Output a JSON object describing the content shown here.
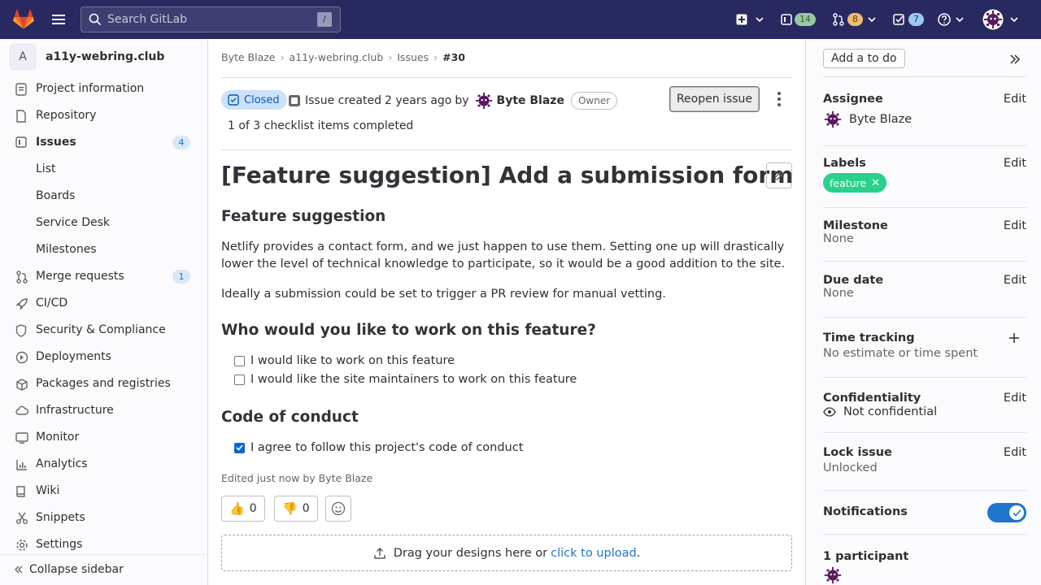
{
  "topbar": {
    "search_placeholder": "Search GitLab",
    "search_shortcut": "/",
    "issues_count": "14",
    "mr_count": "8",
    "todo_count": "7"
  },
  "sidebar": {
    "project_avatar": "A",
    "project_name": "a11y-webring.club",
    "items": [
      {
        "label": "Project information",
        "icon": "info-icon"
      },
      {
        "label": "Repository",
        "icon": "doc-icon"
      },
      {
        "label": "Issues",
        "icon": "issues-icon",
        "badge": "4"
      },
      {
        "label": "List"
      },
      {
        "label": "Boards"
      },
      {
        "label": "Service Desk"
      },
      {
        "label": "Milestones"
      },
      {
        "label": "Merge requests",
        "icon": "merge-request-icon",
        "badge": "1"
      },
      {
        "label": "CI/CD",
        "icon": "rocket-icon"
      },
      {
        "label": "Security & Compliance",
        "icon": "shield-icon"
      },
      {
        "label": "Deployments",
        "icon": "deployments-icon"
      },
      {
        "label": "Packages and registries",
        "icon": "package-icon"
      },
      {
        "label": "Infrastructure",
        "icon": "cloud-icon"
      },
      {
        "label": "Monitor",
        "icon": "monitor-icon"
      },
      {
        "label": "Analytics",
        "icon": "chart-icon"
      },
      {
        "label": "Wiki",
        "icon": "book-icon"
      },
      {
        "label": "Snippets",
        "icon": "scissors-icon"
      },
      {
        "label": "Settings",
        "icon": "settings-icon"
      }
    ],
    "collapse_label": "Collapse sidebar"
  },
  "breadcrumbs": [
    "Byte Blaze",
    "a11y-webring.club",
    "Issues",
    "#30"
  ],
  "issue": {
    "status": "Closed",
    "created_text": "Issue created",
    "created_time": "2 years ago",
    "by": "by",
    "author": "Byte Blaze",
    "role": "Owner",
    "reopen_label": "Reopen issue",
    "checklist_text": "1 of 3 checklist items completed",
    "title": "[Feature suggestion] Add a submission form",
    "h_feature": "Feature suggestion",
    "p1": "Netlify provides a contact form, and we just happen to use them. Setting one up will drastically lower the level of technical knowledge to participate, so it would be a good addition to the site.",
    "p2": "Ideally a submission could be set to trigger a PR review for manual vetting.",
    "h_who": "Who would you like to work on this feature?",
    "cb1": "I would like to work on this feature",
    "cb2": "I would like the site maintainers to work on this feature",
    "h_conduct": "Code of conduct",
    "cb3": "I agree to follow this project's code of conduct",
    "edited": "Edited just now by Byte Blaze",
    "thumbs_up": "0",
    "thumbs_down": "0",
    "drop_text": "Drag your designs here or",
    "drop_link": "click to upload",
    "drop_end": "."
  },
  "right": {
    "todo": "Add a to do",
    "assignee_h": "Assignee",
    "assignee": "Byte Blaze",
    "labels_h": "Labels",
    "label": "feature",
    "label_color": "#29d18a",
    "milestone_h": "Milestone",
    "milestone": "None",
    "due_h": "Due date",
    "due": "None",
    "time_h": "Time tracking",
    "time": "No estimate or time spent",
    "conf_h": "Confidentiality",
    "conf": "Not confidential",
    "lock_h": "Lock issue",
    "lock": "Unlocked",
    "notif_h": "Notifications",
    "participants": "1 participant",
    "edit": "Edit"
  }
}
